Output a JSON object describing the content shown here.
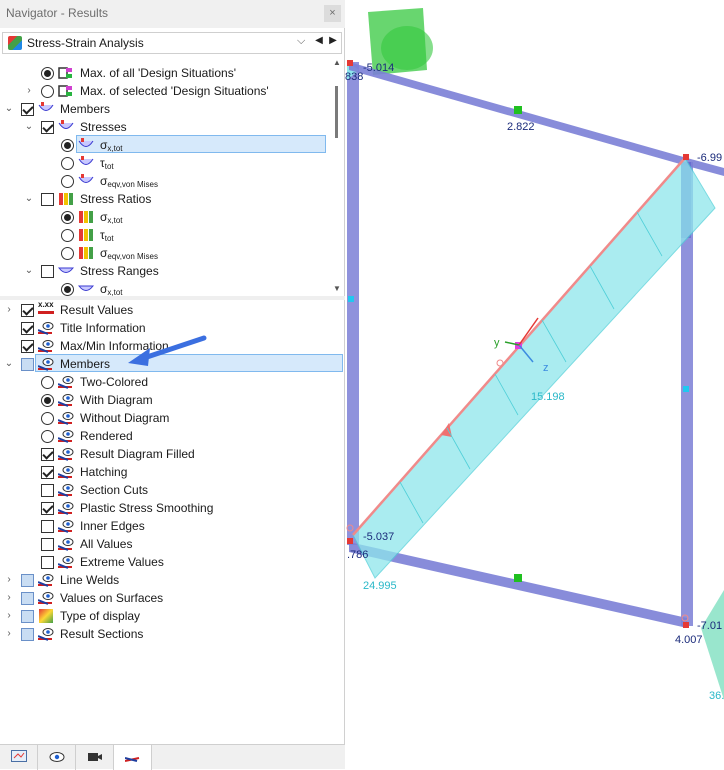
{
  "window": {
    "title": "Navigator - Results",
    "close": "×"
  },
  "dropdown": {
    "value": "Stress-Strain Analysis"
  },
  "tree_top": [
    {
      "label": "Max. of all 'Design Situations'"
    },
    {
      "label": "Max. of selected 'Design Situations'"
    },
    {
      "label": "Members"
    },
    {
      "label": "Stresses"
    },
    {
      "label": "σ",
      "sub": "x,tot"
    },
    {
      "label": "τ",
      "sub": "tot"
    },
    {
      "label": "σ",
      "sub": "eqv,von Mises"
    },
    {
      "label": "Stress Ratios"
    },
    {
      "label": "σ",
      "sub": "x,tot"
    },
    {
      "label": "τ",
      "sub": "tot"
    },
    {
      "label": "σ",
      "sub": "eqv,von Mises"
    },
    {
      "label": "Stress Ranges"
    },
    {
      "label": "σ",
      "sub": "x,tot"
    }
  ],
  "tree_bottom": [
    {
      "label": "Result Values"
    },
    {
      "label": "Title Information"
    },
    {
      "label": "Max/Min Information"
    },
    {
      "label": "Members"
    },
    {
      "label": "Two-Colored"
    },
    {
      "label": "With Diagram"
    },
    {
      "label": "Without Diagram"
    },
    {
      "label": "Rendered"
    },
    {
      "label": "Result Diagram Filled"
    },
    {
      "label": "Hatching"
    },
    {
      "label": "Section Cuts"
    },
    {
      "label": "Plastic Stress Smoothing"
    },
    {
      "label": "Inner Edges"
    },
    {
      "label": "All Values"
    },
    {
      "label": "Extreme Values"
    },
    {
      "label": "Line Welds"
    },
    {
      "label": "Values on Surfaces"
    },
    {
      "label": "Type of display"
    },
    {
      "label": "Result Sections"
    }
  ],
  "result_values_icon_text": "x.xx",
  "bottom_tabs": [
    "data-icon",
    "view-icon",
    "camera-icon",
    "results-icon"
  ],
  "viewport": {
    "labels": {
      "top_left_value": "-5.014",
      "top_left_small": "838",
      "top_mid": "2.822",
      "top_right": "-6.99",
      "center": "15.198",
      "bottom_left_value": "-5.037",
      "bottom_left_small": ".786",
      "bottom_diag": "24.995",
      "bottom_right_value": "-7.01",
      "bottom_right_num": "4.007",
      "far_right": "36."
    },
    "axis_y": "y",
    "axis_z": "z"
  },
  "colors": {
    "selection": "#d6e9fb",
    "member": "#7b7fd6",
    "diagram_fill": "#8ee6ec",
    "support": "#35c83f",
    "arrow": "#3b6fe0"
  }
}
